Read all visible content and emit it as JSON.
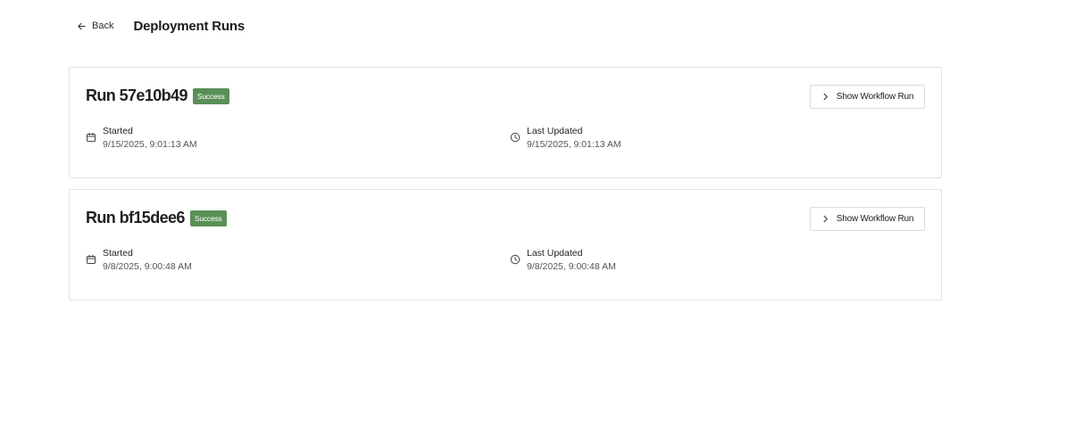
{
  "header": {
    "back_label": "Back",
    "title": "Deployment Runs"
  },
  "runs": [
    {
      "title": "Run 57e10b49",
      "status": "Success",
      "button_label": "Show Workflow Run",
      "started_label": "Started",
      "started_value": "9/15/2025, 9:01:13 AM",
      "updated_label": "Last Updated",
      "updated_value": "9/15/2025, 9:01:13 AM"
    },
    {
      "title": "Run bf15dee6",
      "status": "Success",
      "button_label": "Show Workflow Run",
      "started_label": "Started",
      "started_value": "9/8/2025, 9:00:48 AM",
      "updated_label": "Last Updated",
      "updated_value": "9/8/2025, 9:00:48 AM"
    }
  ],
  "colors": {
    "success_badge": "#5a8f57",
    "card_border": "#e2e2e2"
  },
  "icons": {
    "back": "arrow-left-icon",
    "button": "chevron-right-icon",
    "started": "calendar-icon",
    "updated": "clock-icon"
  }
}
